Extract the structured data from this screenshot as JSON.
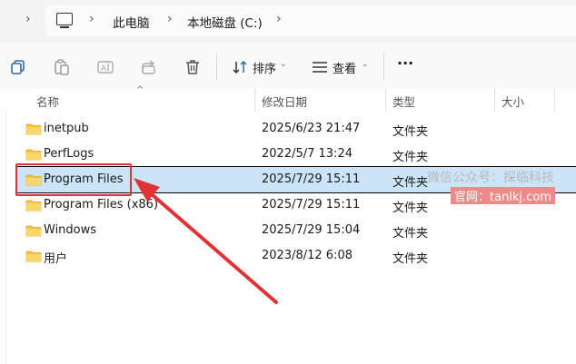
{
  "address": {
    "segments": [
      "此电脑",
      "本地磁盘 (C:)"
    ],
    "icon": "computer-icon"
  },
  "toolbar": {
    "icons": [
      "copy-icon",
      "paste-icon",
      "rename-icon",
      "share-icon",
      "delete-icon"
    ],
    "sort_label": "排序",
    "view_label": "查看",
    "more_label": "···"
  },
  "columns": {
    "name": "名称",
    "modified": "修改日期",
    "type": "类型",
    "size": "大小"
  },
  "files": [
    {
      "name": "inetpub",
      "modified": "2025/6/23 21:47",
      "type": "文件夹",
      "selected": false
    },
    {
      "name": "PerfLogs",
      "modified": "2022/5/7 13:24",
      "type": "文件夹",
      "selected": false
    },
    {
      "name": "Program Files",
      "modified": "2025/7/29 15:11",
      "type": "文件夹",
      "selected": true
    },
    {
      "name": "Program Files (x86)",
      "modified": "2025/7/29 15:11",
      "type": "文件夹",
      "selected": false
    },
    {
      "name": "Windows",
      "modified": "2025/7/29 15:04",
      "type": "文件夹",
      "selected": false
    },
    {
      "name": "用户",
      "modified": "2023/8/12 6:08",
      "type": "文件夹",
      "selected": false
    }
  ],
  "watermark": {
    "line1": "微信公众号：探临科技",
    "line2": "官网：tanlkj.com"
  },
  "colors": {
    "selection": "#cce4f7",
    "highlight": "#e03333",
    "folder": "#f3c342"
  }
}
